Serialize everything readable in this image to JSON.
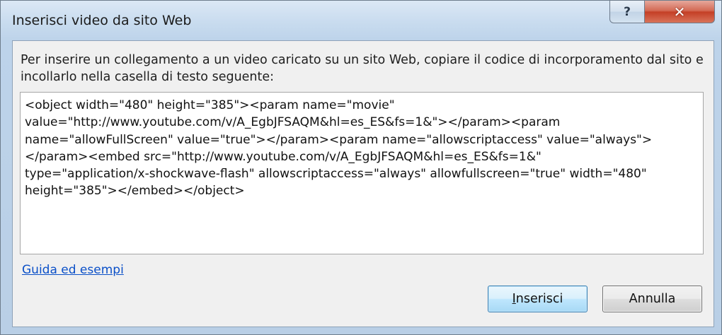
{
  "window": {
    "title": "Inserisci video da sito Web",
    "help_button": "?",
    "close_button": "✕"
  },
  "dialog": {
    "instructions": "Per inserire un collegamento a un video caricato su un sito Web, copiare il codice di incorporamento dal sito e incollarlo nella casella di testo seguente:",
    "embed_code_lines": [
      "<object width=\"480\" height=\"385\"><param name=\"movie\"",
      "value=\"http://www.youtube.com/v/A_EgbJFSAQM&hl=es_ES&fs=1&\"></param><param",
      "name=\"allowFullScreen\" value=\"true\"></param><param name=\"allowscriptaccess\" value=\"always\">",
      "</param><embed src=\"http://www.youtube.com/v/A_EgbJFSAQM&hl=es_ES&fs=1&\"",
      "type=\"application/x-shockwave-flash\" allowscriptaccess=\"always\" allowfullscreen=\"true\" width=\"480\"",
      "height=\"385\"></embed></object>"
    ],
    "help_link": "Guida ed esempi",
    "insert_button": {
      "accel": "I",
      "rest": "nserisci"
    },
    "cancel_button": "Annulla"
  }
}
